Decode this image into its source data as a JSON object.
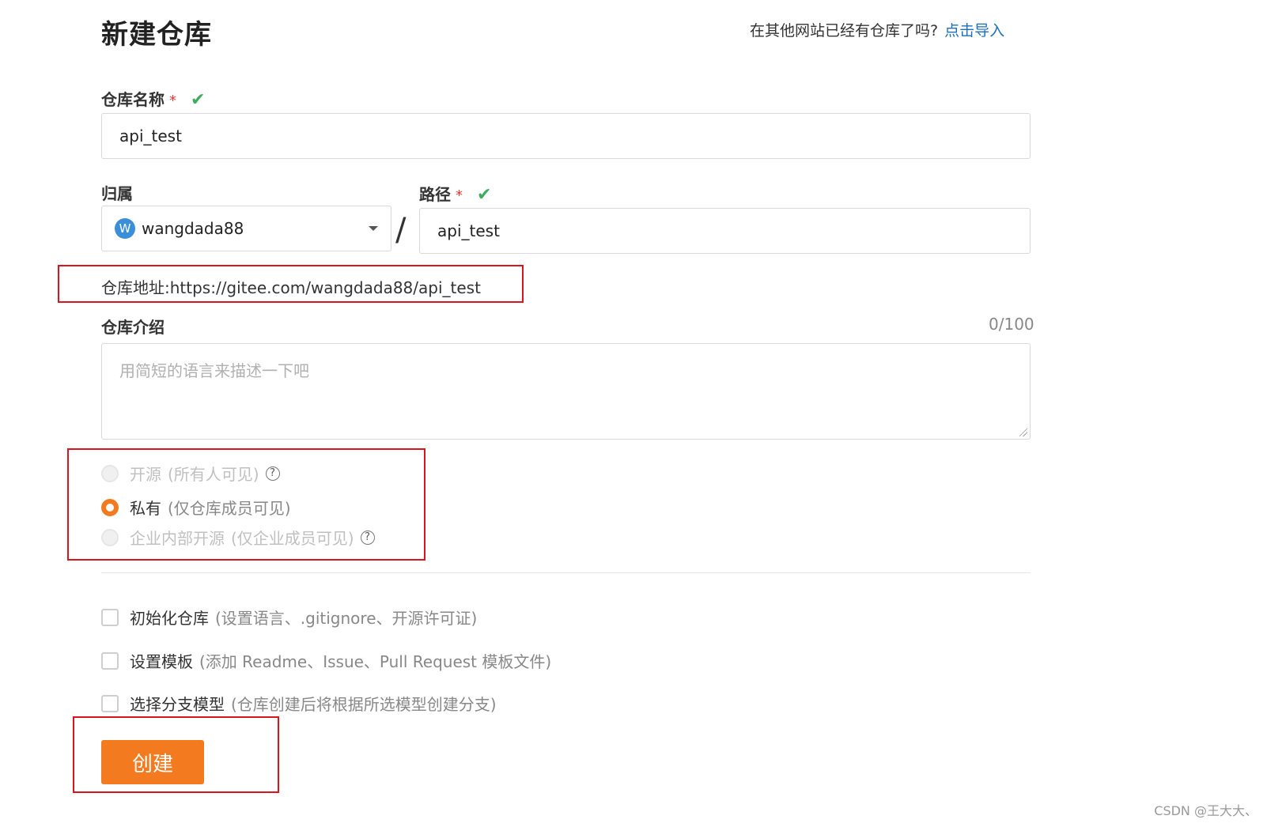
{
  "header": {
    "title": "新建仓库",
    "import_prompt": "在其他网站已经有仓库了吗?",
    "import_link": "点击导入"
  },
  "repo_name": {
    "label": "仓库名称",
    "required_mark": "*",
    "check_icon": "check-icon",
    "value": "api_test"
  },
  "owner": {
    "label": "归属",
    "avatar_letter": "W",
    "value": "wangdada88"
  },
  "separator": "/",
  "path": {
    "label": "路径",
    "required_mark": "*",
    "value": "api_test"
  },
  "address": {
    "text": "仓库地址:https://gitee.com/wangdada88/api_test"
  },
  "description": {
    "label": "仓库介绍",
    "counter": "0/100",
    "placeholder": "用简短的语言来描述一下吧"
  },
  "visibility": {
    "options": [
      {
        "label": "开源",
        "note": "(所有人可见)",
        "selected": false,
        "disabled": true,
        "help": "?"
      },
      {
        "label": "私有",
        "note": "(仅仓库成员可见)",
        "selected": true,
        "disabled": false
      },
      {
        "label": "企业内部开源",
        "note": "(仅企业成员可见)",
        "selected": false,
        "disabled": true,
        "help": "?"
      }
    ]
  },
  "options": [
    {
      "label": "初始化仓库",
      "note": "(设置语言、.gitignore、开源许可证)",
      "checked": false
    },
    {
      "label": "设置模板",
      "note": "(添加 Readme、Issue、Pull Request 模板文件)",
      "checked": false
    },
    {
      "label": "选择分支模型",
      "note": "(仓库创建后将根据所选模型创建分支)",
      "checked": false
    }
  ],
  "submit": {
    "label": "创建"
  },
  "watermark": "CSDN @王大大、",
  "colors": {
    "accent": "#f47a1f",
    "link": "#1d6fb8",
    "success": "#3cad5c",
    "annotation": "#d9141c"
  }
}
